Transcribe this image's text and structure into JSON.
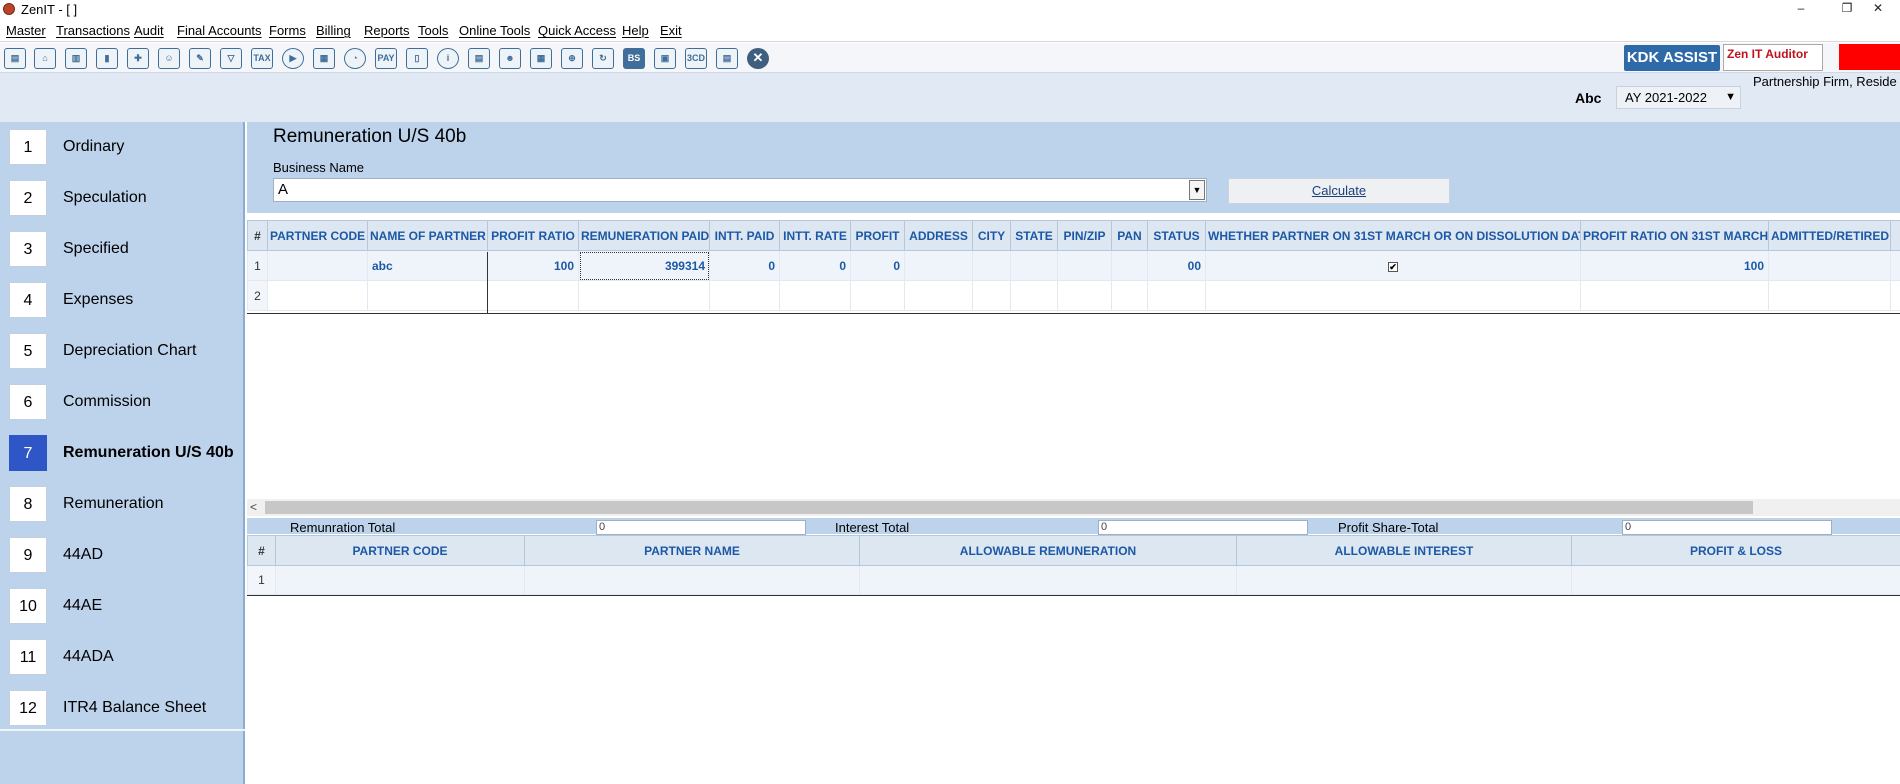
{
  "window": {
    "title": "ZenIT - [ ]",
    "minimize": "–",
    "restore": "❐",
    "close": "✕"
  },
  "menu": [
    {
      "label": "Master"
    },
    {
      "label": "Transactions"
    },
    {
      "label": "Audit"
    },
    {
      "label": "Final Accounts"
    },
    {
      "label": "Forms"
    },
    {
      "label": "Billing"
    },
    {
      "label": "Reports"
    },
    {
      "label": "Tools"
    },
    {
      "label": "Online Tools"
    },
    {
      "label": "Quick Access"
    },
    {
      "label": "Help"
    },
    {
      "label": "Exit"
    }
  ],
  "toolbar": {
    "icons": [
      "chart-file-icon",
      "home-icon",
      "building-icon",
      "bar-chart-icon",
      "gift-icon",
      "users-icon",
      "pin-icon",
      "filter-icon",
      "tax-icon",
      "play-icon",
      "calculator-icon",
      "pie-icon",
      "pay-icon",
      "book-icon",
      "info-icon",
      "report-icon",
      "user-doc-icon",
      "calendar-icon",
      "folder-add-icon",
      "refresh-icon",
      "bs-icon",
      "bs-doc-icon",
      "3cd-icon",
      "document-icon",
      "close-circle-icon"
    ],
    "tax_text": "TAX",
    "pay_text": "PAY",
    "bs_text": "BS",
    "cd_text": "3CD",
    "kdk_label": "KDK ASSIST",
    "auditor_label": "Zen IT Auditor"
  },
  "header": {
    "firm_text": "Partnership Firm, Reside",
    "client": "Abc",
    "ay_value": "AY 2021-2022",
    "ay_arrow": "▼"
  },
  "sidebar": {
    "items": [
      {
        "num": "1",
        "label": "Ordinary"
      },
      {
        "num": "2",
        "label": "Speculation"
      },
      {
        "num": "3",
        "label": "Specified"
      },
      {
        "num": "4",
        "label": "Expenses"
      },
      {
        "num": "5",
        "label": "Depreciation Chart"
      },
      {
        "num": "6",
        "label": "Commission"
      },
      {
        "num": "7",
        "label": "Remuneration U/S 40b",
        "active": true
      },
      {
        "num": "8",
        "label": "Remuneration"
      },
      {
        "num": "9",
        "label": "44AD"
      },
      {
        "num": "10",
        "label": "44AE"
      },
      {
        "num": "11",
        "label": "44ADA"
      },
      {
        "num": "12",
        "label": "ITR4 Balance Sheet"
      }
    ]
  },
  "main": {
    "title": "Remuneration U/S 40b",
    "business_name_label": "Business Name",
    "business_name_value": "A",
    "dropdown_arrow": "▼",
    "calculate_label": "Calculate"
  },
  "top_grid": {
    "columns": [
      "#",
      "PARTNER CODE",
      "NAME OF PARTNER",
      "PROFIT RATIO",
      "REMUNERATION PAID",
      "INTT. PAID",
      "INTT. RATE",
      "PROFIT",
      "ADDRESS",
      "CITY",
      "STATE",
      "PIN/ZIP",
      "PAN",
      "STATUS",
      "WHETHER PARTNER ON 31ST MARCH OR ON DISSOLUTION DATE",
      "PROFIT RATIO ON 31ST MARCH",
      "ADMITTED/RETIRED"
    ],
    "rows": [
      {
        "idx": "1",
        "partner_code": "",
        "name": "abc",
        "profit_ratio": "100",
        "remuneration_paid": "399314",
        "intt_paid": "0",
        "intt_rate": "0",
        "profit": "0",
        "address": "",
        "city": "",
        "state": "",
        "pin": "",
        "pan": "",
        "status": "00",
        "whether_partner": "✔",
        "profit_ratio_31": "100",
        "admitted": ""
      },
      {
        "idx": "2",
        "partner_code": "",
        "name": "",
        "profit_ratio": "",
        "remuneration_paid": "",
        "intt_paid": "",
        "intt_rate": "",
        "profit": "",
        "address": "",
        "city": "",
        "state": "",
        "pin": "",
        "pan": "",
        "status": "",
        "whether_partner": "",
        "profit_ratio_31": "",
        "admitted": ""
      }
    ]
  },
  "scrollbar": {
    "left_arrow": "<"
  },
  "totals": {
    "remuneration_label": "Remunration Total",
    "remuneration_value": "0",
    "interest_label": "Interest Total",
    "interest_value": "0",
    "profit_label": "Profit Share-Total",
    "profit_value": "0"
  },
  "bottom_grid": {
    "columns": [
      "#",
      "PARTNER CODE",
      "PARTNER NAME",
      "ALLOWABLE REMUNERATION",
      "ALLOWABLE INTEREST",
      "PROFIT & LOSS"
    ],
    "rows": [
      {
        "idx": "1"
      }
    ]
  },
  "colors": {
    "accent": "#2f56c7",
    "sidebar_bg": "#bdd3ec",
    "header_text": "#1c58a6",
    "kdk_bg": "#2f6aa8",
    "auditor_text": "#c0121e",
    "alert_red": "#ff0000"
  }
}
